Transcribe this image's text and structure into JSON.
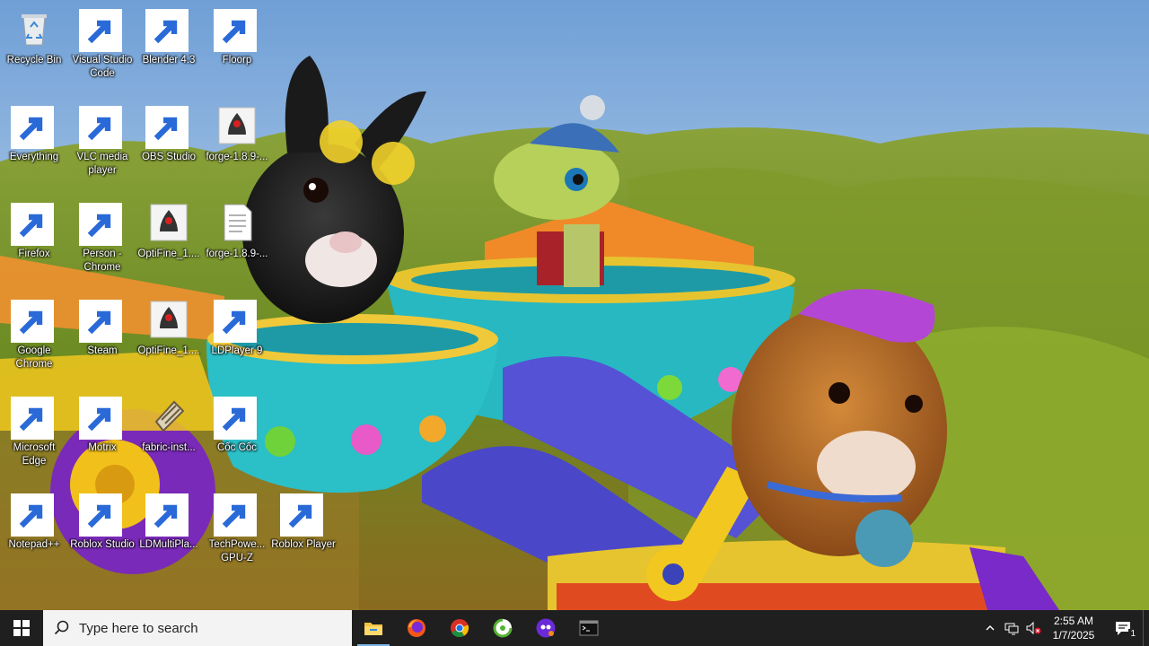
{
  "desktop_icons": [
    {
      "label": "Recycle Bin",
      "icon": "recycle-bin-icon"
    },
    {
      "label": "Visual Studio Code",
      "icon": "vscode-icon"
    },
    {
      "label": "Blender 4.3",
      "icon": "blender-icon"
    },
    {
      "label": "Floorp",
      "icon": "floorp-icon"
    },
    {
      "label": "Everything",
      "icon": "everything-search-icon"
    },
    {
      "label": "VLC media player",
      "icon": "vlc-icon"
    },
    {
      "label": "OBS Studio",
      "icon": "obs-icon"
    },
    {
      "label": "forge-1.8.9-...",
      "icon": "java-icon"
    },
    {
      "label": "Firefox",
      "icon": "firefox-icon"
    },
    {
      "label": "Person - Chrome",
      "icon": "chrome-profile-icon"
    },
    {
      "label": "OptiFine_1....",
      "icon": "java-icon"
    },
    {
      "label": "forge-1.8.9-...",
      "icon": "text-file-icon"
    },
    {
      "label": "Google Chrome",
      "icon": "chrome-icon"
    },
    {
      "label": "Steam",
      "icon": "steam-icon"
    },
    {
      "label": "OptiFine_1....",
      "icon": "java-icon"
    },
    {
      "label": "LDPlayer 9",
      "icon": "ldplayer-icon"
    },
    {
      "label": "Microsoft Edge",
      "icon": "edge-icon"
    },
    {
      "label": "Motrix",
      "icon": "motrix-icon"
    },
    {
      "label": "fabric-inst...",
      "icon": "fabric-icon"
    },
    {
      "label": "Cốc Cốc",
      "icon": "coccoc-icon"
    },
    {
      "label": "Notepad++",
      "icon": "notepadpp-icon"
    },
    {
      "label": "Roblox Studio",
      "icon": "roblox-studio-icon"
    },
    {
      "label": "LDMultiPla...",
      "icon": "ldmultiplayer-icon"
    },
    {
      "label": "TechPowe... GPU-Z",
      "icon": "gpuz-icon"
    },
    {
      "label": "Roblox Player",
      "icon": "roblox-player-icon"
    }
  ],
  "taskbar": {
    "search_placeholder": "Type here to search",
    "pinned": [
      {
        "name": "file-explorer",
        "icon": "folder-icon"
      },
      {
        "name": "firefox",
        "icon": "firefox-icon"
      },
      {
        "name": "chrome",
        "icon": "chrome-icon"
      },
      {
        "name": "coccoc",
        "icon": "coccoc-icon"
      },
      {
        "name": "floorp",
        "icon": "floorp-icon"
      },
      {
        "name": "terminal",
        "icon": "terminal-icon"
      }
    ],
    "clock": {
      "time": "2:55 AM",
      "date": "1/7/2025"
    },
    "notification_count": "1"
  }
}
